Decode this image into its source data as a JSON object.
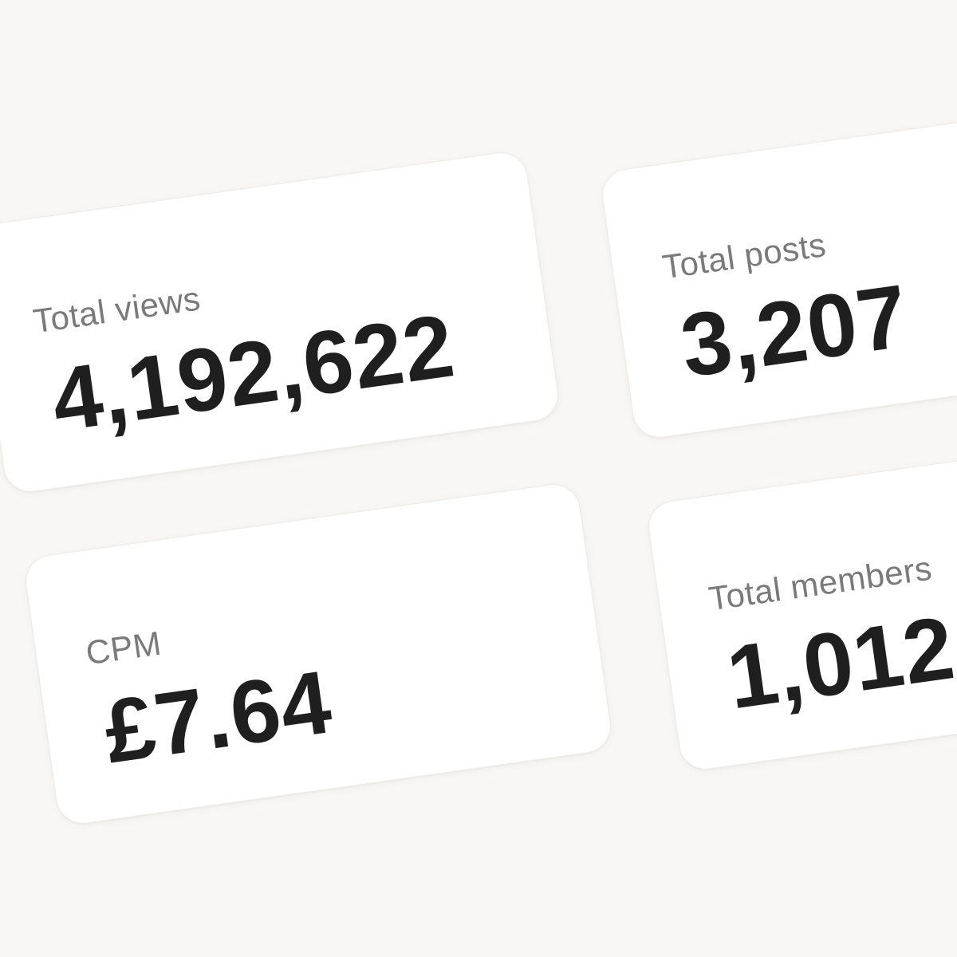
{
  "stats": [
    {
      "label": "Total views",
      "value": "4,192,622"
    },
    {
      "label": "Total posts",
      "value": "3,207"
    },
    {
      "label": "CPM",
      "value": "£7.64"
    },
    {
      "label": "Total members",
      "value": "1,012"
    }
  ],
  "colors": {
    "background": "#f8f7f5",
    "card": "#ffffff",
    "label": "#7a7a7a",
    "value": "#1f1f1f"
  }
}
